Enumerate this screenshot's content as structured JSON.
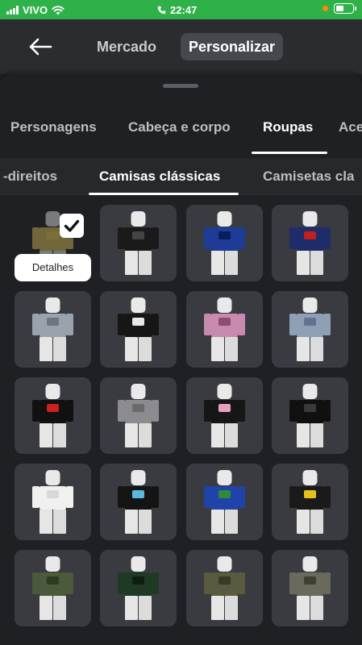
{
  "status": {
    "carrier": "VIVO",
    "time": "22:47",
    "icons": [
      "signal-icon",
      "wifi-icon",
      "phone-icon",
      "battery-icon"
    ]
  },
  "header": {
    "tabs": [
      {
        "label": "Mercado",
        "active": false
      },
      {
        "label": "Personalizar",
        "active": true
      }
    ]
  },
  "categories": [
    {
      "label": "Personagens",
      "active": false
    },
    {
      "label": "Cabeça e corpo",
      "active": false
    },
    {
      "label": "Roupas",
      "active": true
    },
    {
      "label": "Aces",
      "active": false
    }
  ],
  "subcategories": [
    {
      "label": "-direitos",
      "active": false
    },
    {
      "label": "Camisas clássicas",
      "active": true
    },
    {
      "label": "Camisetas cla",
      "active": false
    }
  ],
  "selected_item": {
    "details_label": "Detalhes",
    "checked": true
  },
  "items": [
    {
      "shirt": "#d6bf57",
      "accent": "#8a7b36",
      "selected": true
    },
    {
      "shirt": "#1a1a1a",
      "accent": "#444444"
    },
    {
      "shirt": "#1e3c96",
      "accent": "#0b1d5a"
    },
    {
      "shirt": "#1e2c6a",
      "accent": "#c41f1f"
    },
    {
      "shirt": "#9aa3ad",
      "accent": "#6d7580"
    },
    {
      "shirt": "#161616",
      "accent": "#e8e8e8"
    },
    {
      "shirt": "#c98ab0",
      "accent": "#8e4b74"
    },
    {
      "shirt": "#8ea0b6",
      "accent": "#5f7391"
    },
    {
      "shirt": "#111111",
      "accent": "#cc2020"
    },
    {
      "shirt": "#8c8c90",
      "accent": "#6a6a6e"
    },
    {
      "shirt": "#161616",
      "accent": "#e8a0c0"
    },
    {
      "shirt": "#101010",
      "accent": "#3a3a3a"
    },
    {
      "shirt": "#f0f0f0",
      "accent": "#d8d8d8"
    },
    {
      "shirt": "#141414",
      "accent": "#5bb8e0"
    },
    {
      "shirt": "#1f43a8",
      "accent": "#2e8b3a"
    },
    {
      "shirt": "#1a1a1a",
      "accent": "#e5c21a"
    },
    {
      "shirt": "#4a5a3a",
      "accent": "#2c3a22"
    },
    {
      "shirt": "#1e3a24",
      "accent": "#0e1e12"
    },
    {
      "shirt": "#5a5a40",
      "accent": "#3a3a28"
    },
    {
      "shirt": "#6a6a5c",
      "accent": "#3e3e34"
    }
  ]
}
